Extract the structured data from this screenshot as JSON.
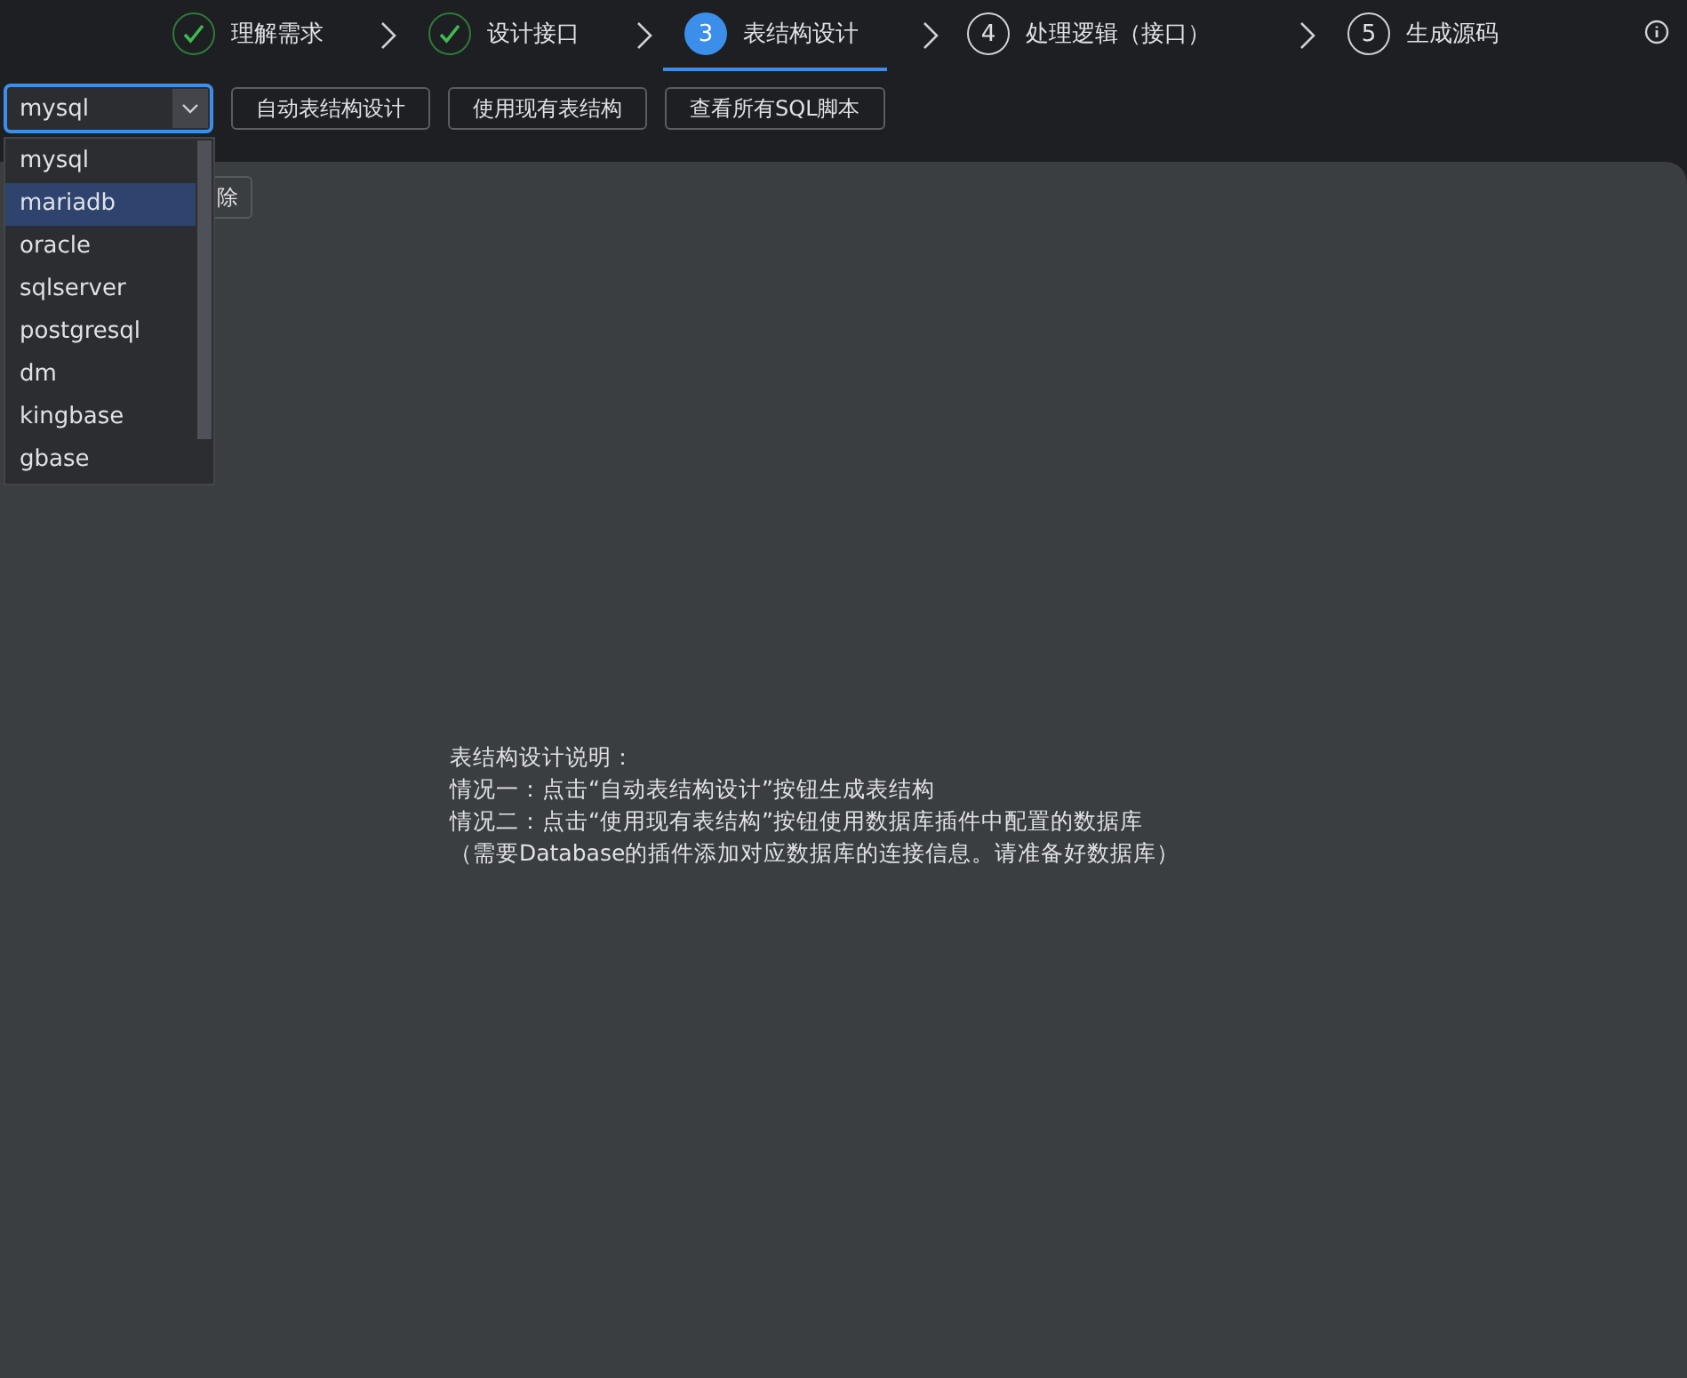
{
  "steps": [
    {
      "label": "理解需求",
      "kind": "done"
    },
    {
      "label": "设计接口",
      "kind": "done"
    },
    {
      "number": "3",
      "label": "表结构设计",
      "kind": "current"
    },
    {
      "number": "4",
      "label": "处理逻辑（接口）",
      "kind": "pending"
    },
    {
      "number": "5",
      "label": "生成源码",
      "kind": "pending"
    }
  ],
  "toolbar": {
    "db_select": {
      "value": "mysql",
      "expanded": true,
      "options": [
        {
          "label": "mysql",
          "highlighted": false
        },
        {
          "label": "mariadb",
          "highlighted": true
        },
        {
          "label": "oracle",
          "highlighted": false
        },
        {
          "label": "sqlserver",
          "highlighted": false
        },
        {
          "label": "postgresql",
          "highlighted": false
        },
        {
          "label": "dm",
          "highlighted": false
        },
        {
          "label": "kingbase",
          "highlighted": false
        },
        {
          "label": "gbase",
          "highlighted": false
        }
      ]
    },
    "buttons": [
      "自动表结构设计",
      "使用现有表结构",
      "查看所有SQL脚本"
    ]
  },
  "panel": {
    "partial_button": "除",
    "description": [
      "表结构设计说明：",
      "情况一：点击“自动表结构设计”按钮生成表结构",
      "情况二：点击“使用现有表结构”按钮使用数据库插件中配置的数据库",
      "（需要Database的插件添加对应数据库的连接信息。请准备好数据库）"
    ]
  }
}
